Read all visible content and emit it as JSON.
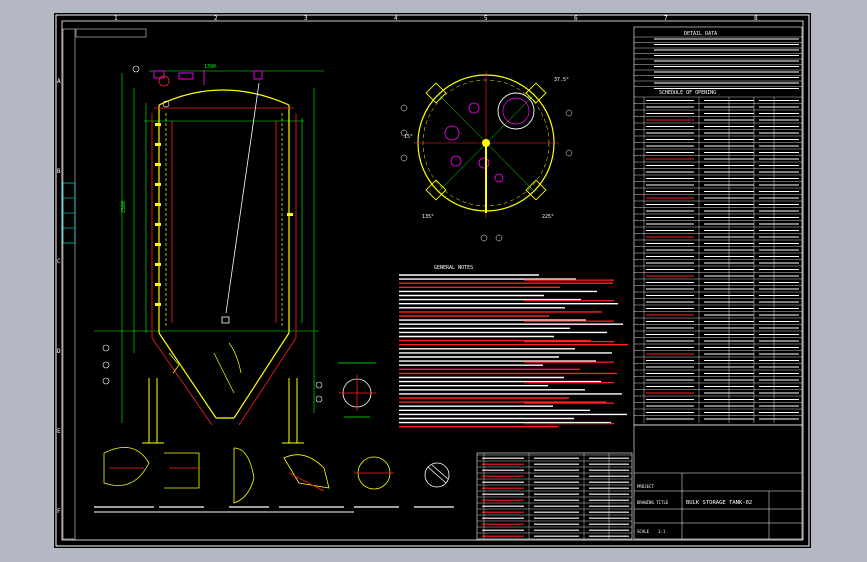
{
  "drawing": {
    "title_block": {
      "project_label": "PROJECT",
      "drawing_title_label": "DRAWING TITLE",
      "drawing_title": "BULK STORAGE TANK-02",
      "scale_label": "SCALE",
      "scale_value": "1:1"
    },
    "sections": {
      "detail_data": "DETAIL DATA",
      "schedule_of_openings": "SCHEDULE OF OPENING",
      "general_notes": "GENERAL NOTES"
    },
    "view_labels": {
      "dim_top": "1390",
      "dim_height": "2500",
      "angle_left": "15°",
      "angle_right": "37.5°",
      "angle_bottom_left": "135°",
      "angle_bottom_right": "225°"
    },
    "grid_letters": [
      "A",
      "B",
      "C",
      "D",
      "E",
      "F"
    ],
    "grid_numbers": [
      "1",
      "2",
      "3",
      "4",
      "5",
      "6",
      "7",
      "8"
    ]
  },
  "colors": {
    "background": "#000000",
    "outer_frame": "#ffffff",
    "vessel_yellow": "#ffff00",
    "hatch_red": "#ff2020",
    "dims_green": "#00ff00",
    "notes_white": "#ffffff",
    "cyan": "#00ffff",
    "magenta": "#ff00ff",
    "viewport_bg": "#b3b8c2"
  }
}
